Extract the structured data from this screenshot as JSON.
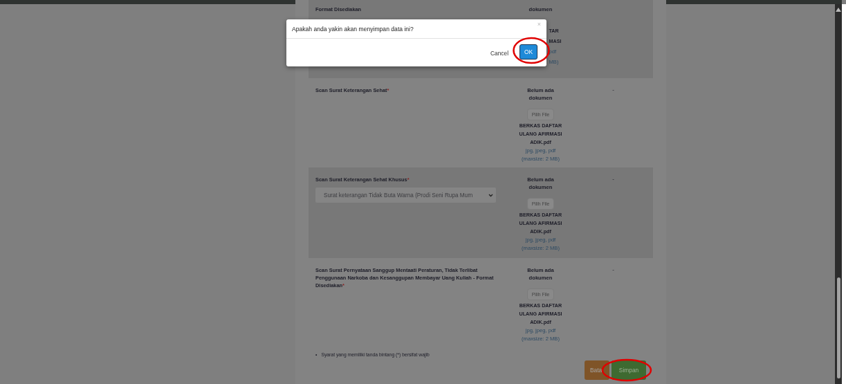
{
  "top_row": {
    "label": "Format Disediakan",
    "status": "dokumen",
    "fragments": [
      "TAR",
      "MASI",
      "pdf",
      "MB)"
    ]
  },
  "rows": [
    {
      "label": "Scan Surat Keterangan Sehat",
      "required": true,
      "shaded": false,
      "status": "Belum ada dokumen",
      "button": "Pilih File",
      "file": "BERKAS DAFTAR ULANG AFIRMASI ADIK.pdf",
      "types": "jpg, jpeg, pdf",
      "maxsize": "(maxsize: 2 MB)",
      "note": "-"
    },
    {
      "label": "Scan Surat Keterangan Sehat Khusus",
      "required": true,
      "shaded": true,
      "select": "Surat keterangan Tidak Buta Warna (Prodi Seni Rupa Murn",
      "status": "Belum ada dokumen",
      "button": "Pilih File",
      "file": "BERKAS DAFTAR ULANG AFIRMASI ADIK.pdf",
      "types": "jpg, jpeg, pdf",
      "maxsize": "(maxsize: 2 MB)",
      "note": "-"
    },
    {
      "label": "Scan Surat Pernyataan Sanggup Mentaati Peraturan, Tidak Terlibat Penggunaan Narkoba dan Kesanggupan Membayar Uang Kuliah - Format Disediakan",
      "required": true,
      "shaded": false,
      "status": "Belum ada dokumen",
      "button": "Pilih File",
      "file": "BERKAS DAFTAR ULANG AFIRMASI ADIK.pdf",
      "types": "jpg, jpeg, pdf",
      "maxsize": "(maxsize: 2 MB)",
      "note": "-"
    }
  ],
  "bullet": "•",
  "footnote": "Syarat yang memiliki tanda bintang (*) bersifat wajib",
  "required_mark": "*",
  "actions": [
    {
      "label": "Bata",
      "kind": "cancel",
      "highlighted": false
    },
    {
      "label": "Simpan",
      "kind": "save",
      "highlighted": true
    }
  ],
  "dialog": {
    "message": "Apakah anda yakin akan menyimpan data ini?",
    "close": "×",
    "buttons": [
      {
        "label": "Cancel",
        "kind": "cancel",
        "highlighted": false
      },
      {
        "label": "OK",
        "kind": "ok",
        "highlighted": true
      }
    ]
  }
}
